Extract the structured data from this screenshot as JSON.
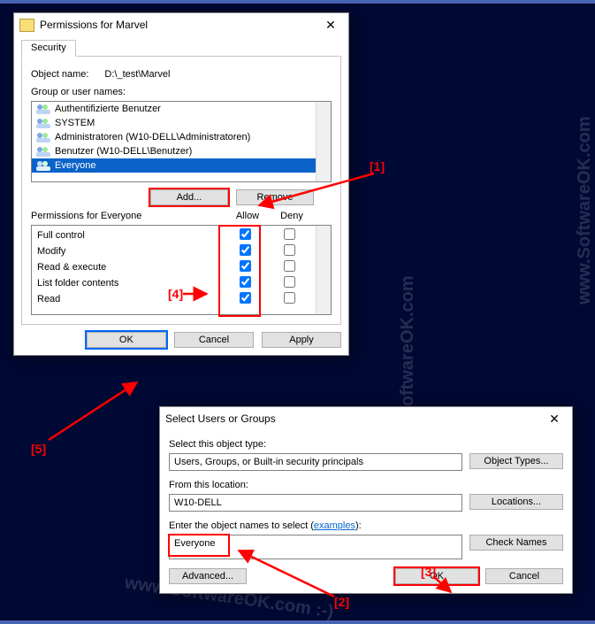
{
  "watermark": "www.SoftwareOK.com :-)",
  "annotations": {
    "a1": "[1]",
    "a2": "[2]",
    "a3": "[3]",
    "a4": "[4]",
    "a5": "[5]"
  },
  "perm_window": {
    "title": "Permissions for Marvel",
    "tab": "Security",
    "object_label": "Object name:",
    "object_path": "D:\\_test\\Marvel",
    "group_label": "Group or user names:",
    "groups": [
      "Authentifizierte Benutzer",
      "SYSTEM",
      "Administratoren (W10-DELL\\Administratoren)",
      "Benutzer (W10-DELL\\Benutzer)",
      "Everyone"
    ],
    "add_btn": "Add...",
    "remove_btn": "Remove",
    "perm_header": "Permissions for Everyone",
    "col_allow": "Allow",
    "col_deny": "Deny",
    "perms": [
      {
        "name": "Full control",
        "allow": true,
        "deny": false
      },
      {
        "name": "Modify",
        "allow": true,
        "deny": false
      },
      {
        "name": "Read & execute",
        "allow": true,
        "deny": false
      },
      {
        "name": "List folder contents",
        "allow": true,
        "deny": false
      },
      {
        "name": "Read",
        "allow": true,
        "deny": false
      }
    ],
    "ok_btn": "OK",
    "cancel_btn": "Cancel",
    "apply_btn": "Apply"
  },
  "select_window": {
    "title": "Select Users or Groups",
    "obj_type_label": "Select this object type:",
    "obj_type_value": "Users, Groups, or Built-in security principals",
    "obj_types_btn": "Object Types...",
    "loc_label": "From this location:",
    "loc_value": "W10-DELL",
    "loc_btn": "Locations...",
    "names_label_a": "Enter the object names to select (",
    "names_label_link": "examples",
    "names_label_b": "):",
    "names_value": "Everyone",
    "check_btn": "Check Names",
    "advanced_btn": "Advanced...",
    "ok_btn": "OK",
    "cancel_btn": "Cancel"
  }
}
